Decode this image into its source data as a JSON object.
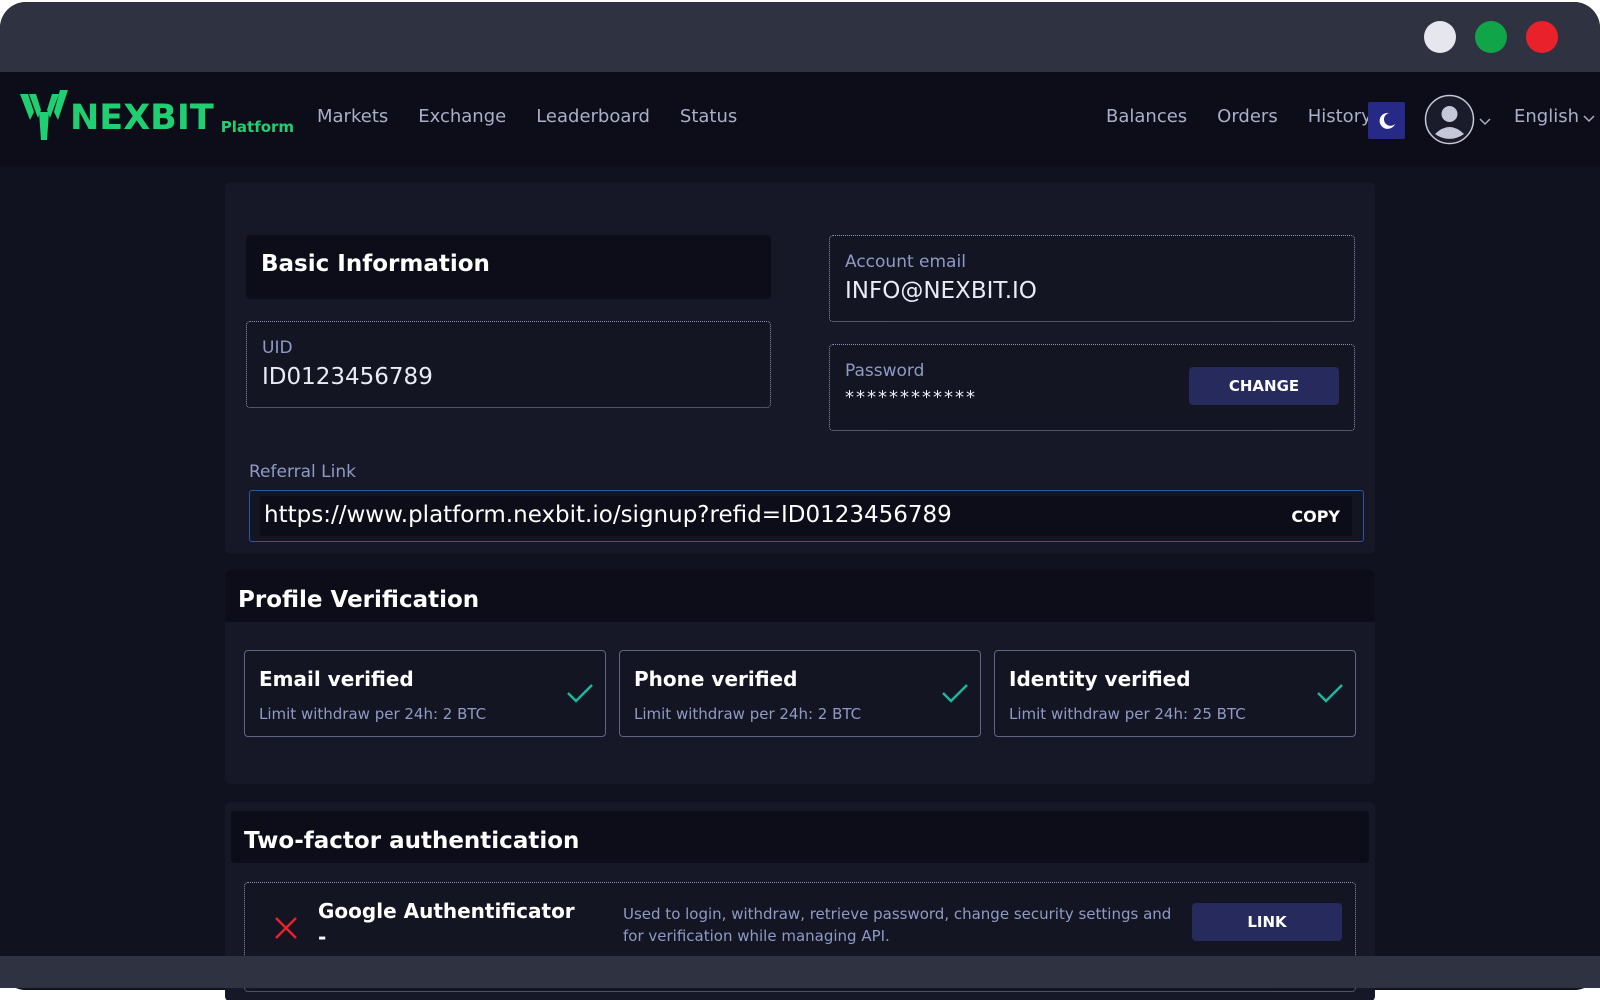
{
  "window": {
    "controls": [
      "light-dot",
      "green-dot",
      "red-dot"
    ]
  },
  "brand": {
    "name": "NEXBIT",
    "sub": "Platform",
    "color": "#1fcf72"
  },
  "nav": {
    "markets": "Markets",
    "exchange": "Exchange",
    "leaderboard": "Leaderboard",
    "status": "Status",
    "balances": "Balances",
    "orders": "Orders",
    "history": "History",
    "language": "English"
  },
  "basic": {
    "title": "Basic Information",
    "uid_label": "UID",
    "uid_value": "ID0123456789",
    "email_label": "Account email",
    "email_value": "INFO@NEXBIT.IO",
    "password_label": "Password",
    "password_value": "************",
    "change_label": "CHANGE",
    "referral_label": "Referral Link",
    "referral_url": "https://www.platform.nexbit.io/signup?refid=ID0123456789",
    "copy_label": "COPY"
  },
  "profile": {
    "title": "Profile Verification",
    "items": [
      {
        "title": "Email verified",
        "sub": "Limit withdraw per 24h: 2 BTC"
      },
      {
        "title": "Phone verified",
        "sub": "Limit withdraw per 24h: 2 BTC"
      },
      {
        "title": "Identity verified",
        "sub": "Limit withdraw per 24h: 25 BTC"
      }
    ]
  },
  "tfa": {
    "title": "Two-factor authentication",
    "name": "Google Authentificator",
    "status": "-",
    "description": "Used to login, withdraw, retrieve password, change security settings and for verification while managing API.",
    "link_label": "LINK"
  },
  "colors": {
    "accent": "#1fcf72",
    "button": "#262a5c",
    "check": "#1fb79b",
    "error": "#e8212b"
  }
}
